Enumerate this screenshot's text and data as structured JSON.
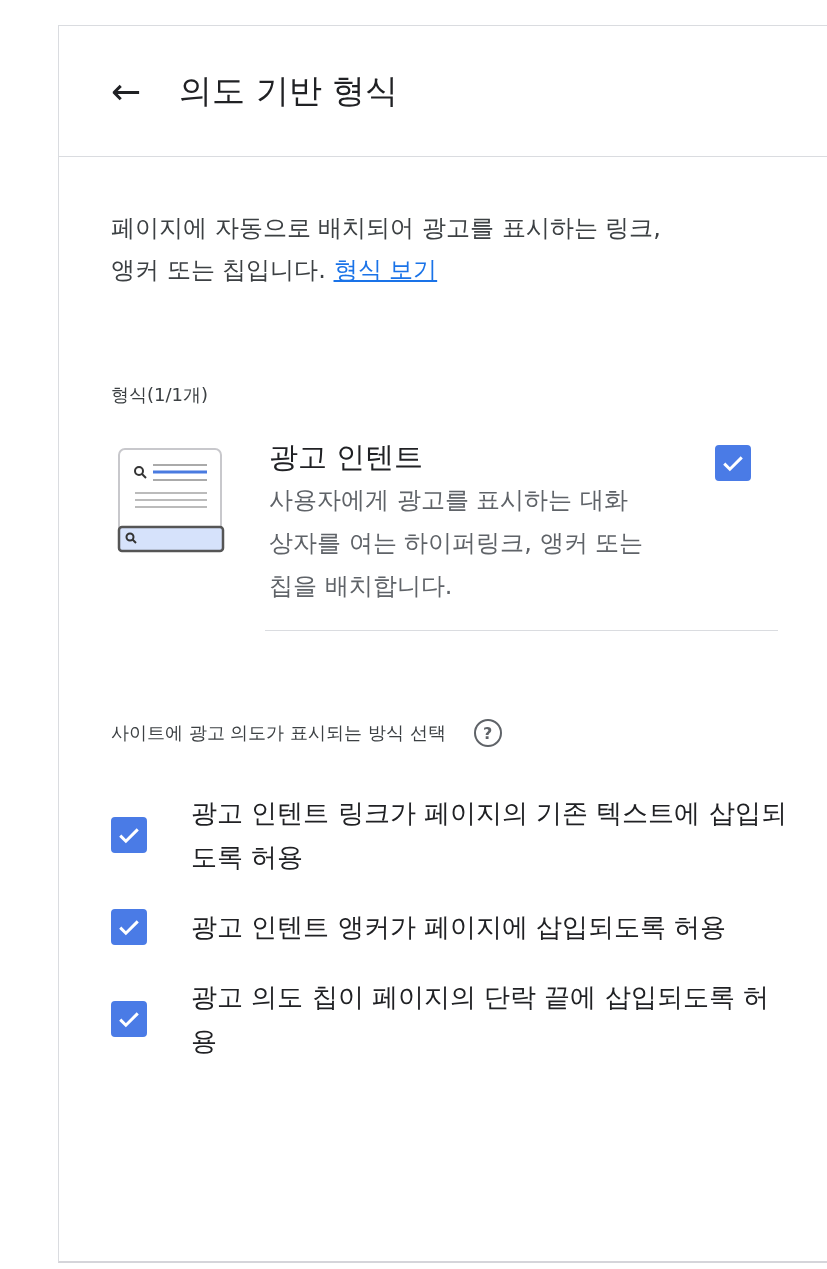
{
  "header": {
    "back_icon": "←",
    "title": "의도 기반 형식"
  },
  "description": {
    "text": "페이지에 자동으로 배치되어 광고를 표시하는 링크, 앵커 또는 칩입니다.",
    "link": "형식 보기"
  },
  "formats": {
    "label": "형식(1/1개)",
    "items": [
      {
        "title": "광고 인텐트",
        "description": "사용자에게 광고를 표시하는 대화 상자를 여는 하이퍼링크, 앵커 또는 칩을 배치합니다.",
        "checked": true
      }
    ]
  },
  "display": {
    "label": "사이트에 광고 의도가 표시되는 방식 선택",
    "help_icon": "?",
    "options": [
      {
        "label": "광고 인텐트 링크가 페이지의 기존 텍스트에 삽입되도록 허용",
        "checked": true
      },
      {
        "label": "광고 인텐트 앵커가 페이지에 삽입되도록 허용",
        "checked": true
      },
      {
        "label": "광고 의도 칩이 페이지의 단락 끝에 삽입되도록 허용",
        "checked": true
      }
    ]
  }
}
